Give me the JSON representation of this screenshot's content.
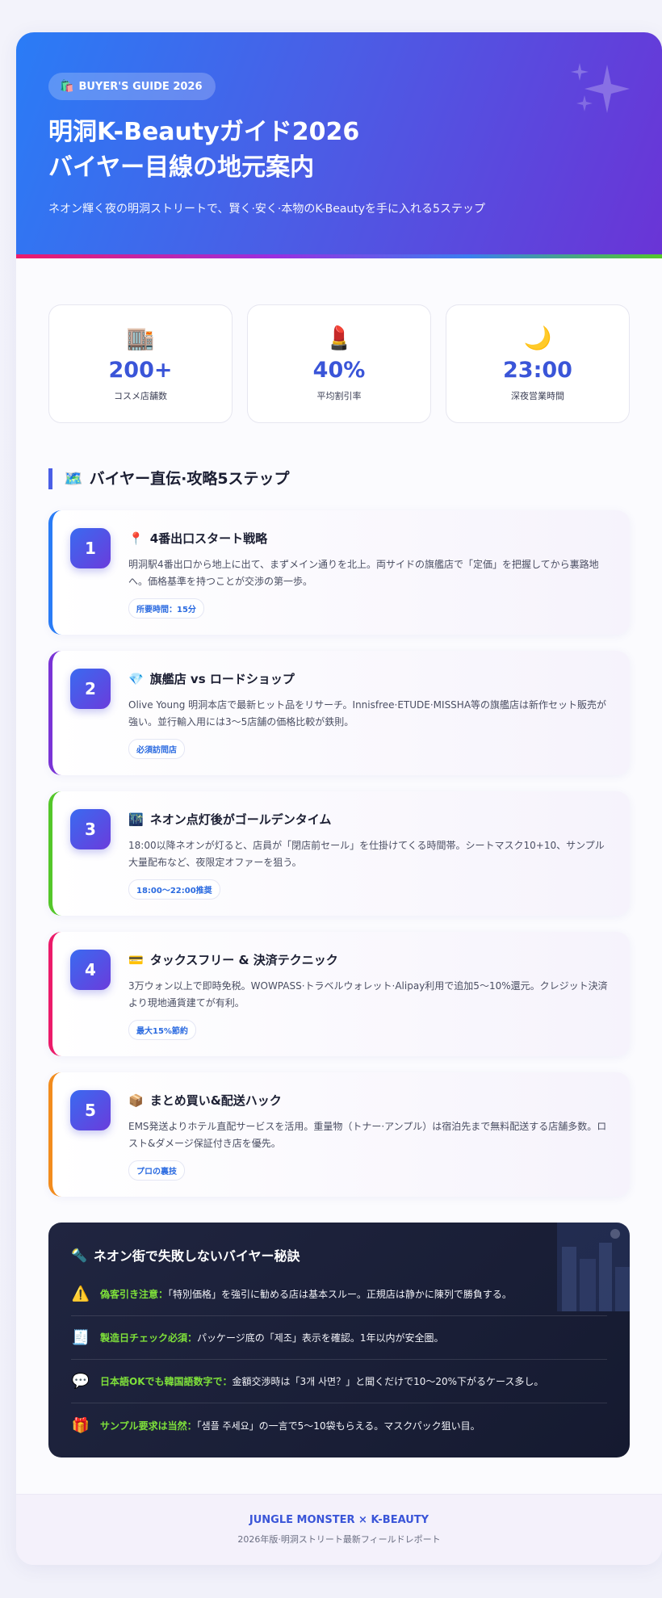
{
  "hero": {
    "badge_icon": "shopping-bags-icon",
    "badge_emoji": "🛍️",
    "badge": "BUYER'S GUIDE 2026",
    "title_line1": "明洞K-Beautyガイド2026",
    "title_line2": "バイヤー目線の地元案内",
    "subtitle": "ネオン輝く夜の明洞ストリートで、賢く·安く·本物のK-Beautyを手に入れる5ステップ"
  },
  "stats": [
    {
      "icon": "🏬",
      "value": "200+",
      "label": "コスメ店舗数"
    },
    {
      "icon": "💄",
      "value": "40%",
      "label": "平均割引率"
    },
    {
      "icon": "🌙",
      "value": "23:00",
      "label": "深夜営業時間"
    }
  ],
  "steps_section": {
    "icon": "🗺️",
    "title": "バイヤー直伝·攻略5ステップ"
  },
  "steps": [
    {
      "num": "1",
      "icon": "📍",
      "title": "4番出口スタート戦略",
      "color": "#2a7cf6",
      "desc": "明洞駅4番出口から地上に出て、まずメイン通りを北上。両サイドの旗艦店で「定価」を把握してから裏路地へ。価格基準を持つことが交渉の第一歩。",
      "tag": "所要時間：15分"
    },
    {
      "num": "2",
      "icon": "💎",
      "title": "旗艦店 vs ロードショップ",
      "color": "#7a34d6",
      "desc": "Olive Young 明洞本店で最新ヒット品をリサーチ。Innisfree·ETUDE·MISSHA等の旗艦店は新作セット販売が強い。並行輸入用には3～5店舗の価格比較が鉄則。",
      "tag": "必須訪問店"
    },
    {
      "num": "3",
      "icon": "🌃",
      "title": "ネオン点灯後がゴールデンタイム",
      "color": "#54c72a",
      "desc": "18:00以降ネオンが灯ると、店員が「閉店前セール」を仕掛けてくる時間帯。シートマスク10+10、サンプル大量配布など、夜限定オファーを狙う。",
      "tag": "18:00～22:00推奨"
    },
    {
      "num": "4",
      "icon": "💳",
      "title": "タックスフリー & 決済テクニック",
      "color": "#ec1b6a",
      "desc": "3万ウォン以上で即時免税。WOWPASS·トラベルウォレット·Alipay利用で追加5～10%還元。クレジット決済より現地通貨建てが有利。",
      "tag": "最大15%節約"
    },
    {
      "num": "5",
      "icon": "📦",
      "title": "まとめ買い&配送ハック",
      "color": "#f28c1e",
      "desc": "EMS発送よりホテル直配サービスを活用。重量物（トナー·アンプル）は宿泊先まで無料配送する店舗多数。ロスト&ダメージ保証付き店を優先。",
      "tag": "プロの裏技"
    }
  ],
  "tips": {
    "icon": "🔦",
    "title": "ネオン街で失敗しないバイヤー秘訣",
    "items": [
      {
        "icon": "⚠️",
        "key": "偽客引き注意：",
        "text": "「特別価格」を強引に勧める店は基本スルー。正規店は静かに陳列で勝負する。"
      },
      {
        "icon": "🧾",
        "key": "製造日チェック必須：",
        "text": "パッケージ底の「제조」表示を確認。1年以内が安全圏。"
      },
      {
        "icon": "💬",
        "key": "日本語OKでも韓国語数字で：",
        "text": "金額交渉時は「3개 사면？」と聞くだけで10～20%下がるケース多し。"
      },
      {
        "icon": "🎁",
        "key": "サンプル要求は当然：",
        "text": "「샘플 주세요」の一言で5～10袋もらえる。マスクパック狙い目。"
      }
    ]
  },
  "footer": {
    "brand": "JUNGLE MONSTER × K-BEAUTY",
    "sub": "2026年版·明洞ストリート最新フィールドレポート"
  }
}
